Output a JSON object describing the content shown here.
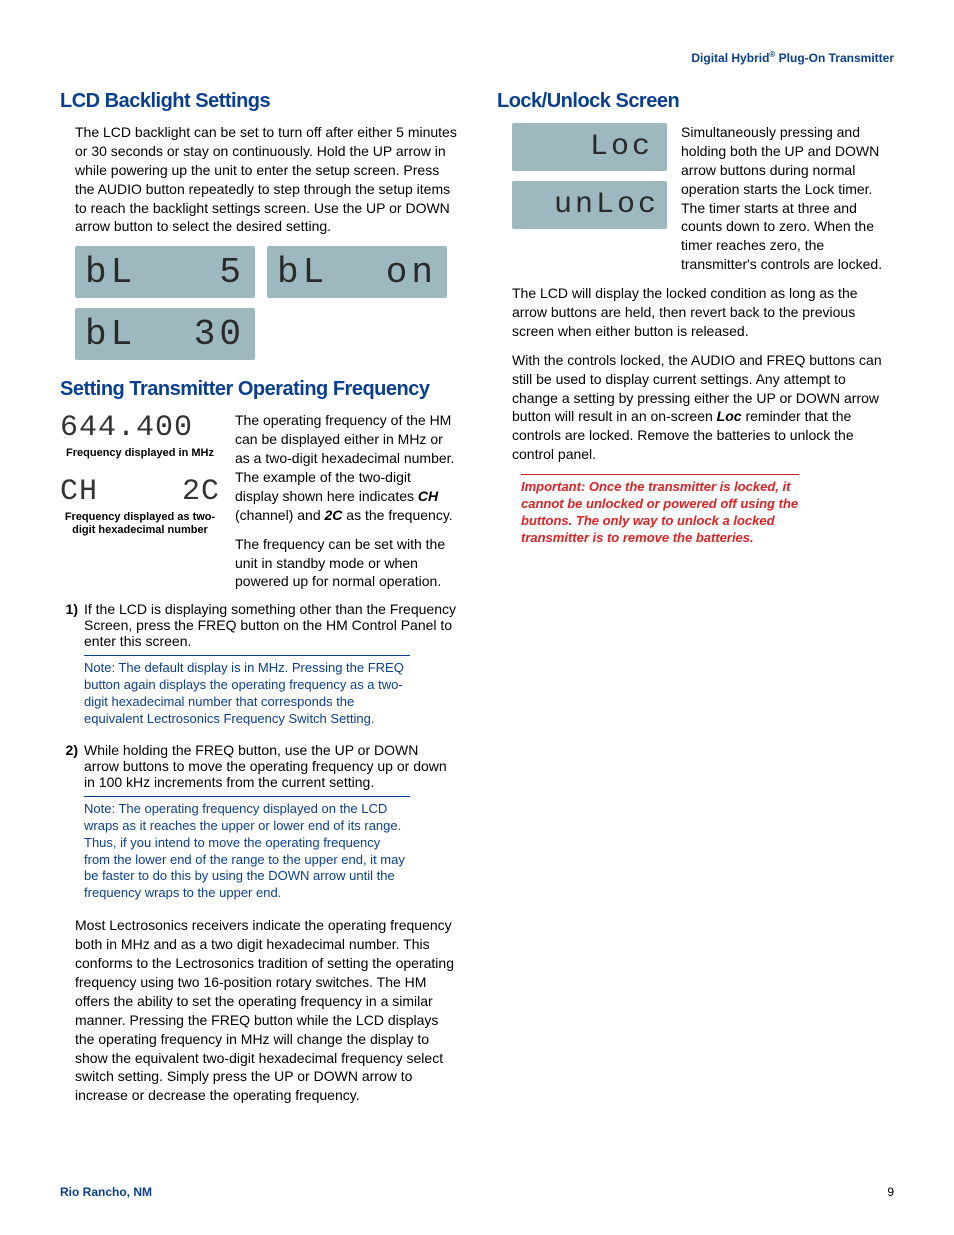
{
  "header": {
    "brand_prefix": "Digital Hybrid",
    "brand_suffix": " Plug-On Transmitter"
  },
  "left": {
    "h_backlight": "LCD Backlight Settings",
    "p_backlight": "The LCD backlight can be set to turn off after either 5 minutes or 30 seconds or stay on continuously. Hold the UP arrow in while powering up the unit to enter the setup screen. Press the AUDIO button repeatedly to step through the setup items to reach the backlight settings screen. Use the UP or DOWN arrow button to select the desired setting.",
    "lcd_bl5_left": "bL",
    "lcd_bl5_right": "5",
    "lcd_blon_left": "bL",
    "lcd_blon_right": "on",
    "lcd_bl30_left": "bL",
    "lcd_bl30_right": "30",
    "h_freq": "Setting Transmitter Operating Frequency",
    "lcd_freq_mhz": "644.400",
    "cap_mhz": "Frequency displayed in MHz",
    "lcd_freq_hex_left": "CH",
    "lcd_freq_hex_right": "2C",
    "cap_hex": "Frequency displayed as two-digit hexadecimal number",
    "p_freq_intro_a": "The operating frequency of the HM can be displayed either in MHz or as a two-digit hexadecimal number. The example of the two-digit display shown here indicates ",
    "p_freq_intro_b": " (channel) and ",
    "p_freq_intro_c": " as the frequency.",
    "ch_bold": "CH",
    "twoc_bold": "2C",
    "p_freq_standby": "The frequency can be set with the unit in standby mode or when powered up for normal operation.",
    "step1": "If the LCD is displaying something other than the Frequency Screen, press the FREQ button on the HM Control Panel to enter this screen.",
    "note1": "Note: The default display is in MHz. Pressing the FREQ button again displays the operating frequency as a two-digit hexadecimal number that corresponds the equivalent Lectrosonics Frequency Switch Setting.",
    "step2": "While holding the FREQ button, use the UP or DOWN arrow buttons to move the operating frequency up or down in 100 kHz increments from the current setting.",
    "note2": "Note: The operating frequency displayed on the LCD wraps as it reaches the upper or lower end of its range. Thus, if you intend to move the operating frequency from the lower end of the range to the upper end, it may be faster to do this by using the DOWN arrow until the frequency wraps to the upper end.",
    "p_freq_big": "Most Lectrosonics receivers indicate the operating frequency both in MHz and as a two digit hexadecimal number. This conforms to the Lectrosonics tradition of setting the operating frequency using two 16-position rotary switches. The HM offers the ability to set the operating frequency in a similar manner. Pressing the FREQ button while the LCD displays the operating frequency in MHz will change the display to show the equivalent two-digit hexadecimal frequency select switch setting. Simply press the UP or DOWN arrow to increase or decrease the operating frequency."
  },
  "right": {
    "h_lock": "Lock/Unlock Screen",
    "lcd_loc": "Loc",
    "lcd_unloc": "unLoc",
    "p_lock1": "Simultaneously pressing and holding both the UP and DOWN arrow buttons during normal operation starts the Lock timer. The timer starts at three and counts down to zero. When the timer reaches zero, the transmitter's controls are locked.",
    "p_lock2": "The LCD will display the locked condition as long as the arrow buttons are held, then revert back to the previous screen when either button is released.",
    "p_lock3_a": "With the controls locked, the AUDIO and FREQ buttons can still be used to display current settings. Any attempt to change a setting by pressing either the UP or DOWN arrow button will result in an on-screen ",
    "p_lock3_b": " reminder that the controls are locked. Remove the batteries to unlock the control panel.",
    "loc_bold": "Loc",
    "important": "Important:  Once the transmitter is locked, it cannot be unlocked or powered off using the buttons. The only way to unlock a locked transmitter is to remove the batteries."
  },
  "footer": {
    "left": "Rio Rancho, NM",
    "right": "9"
  }
}
